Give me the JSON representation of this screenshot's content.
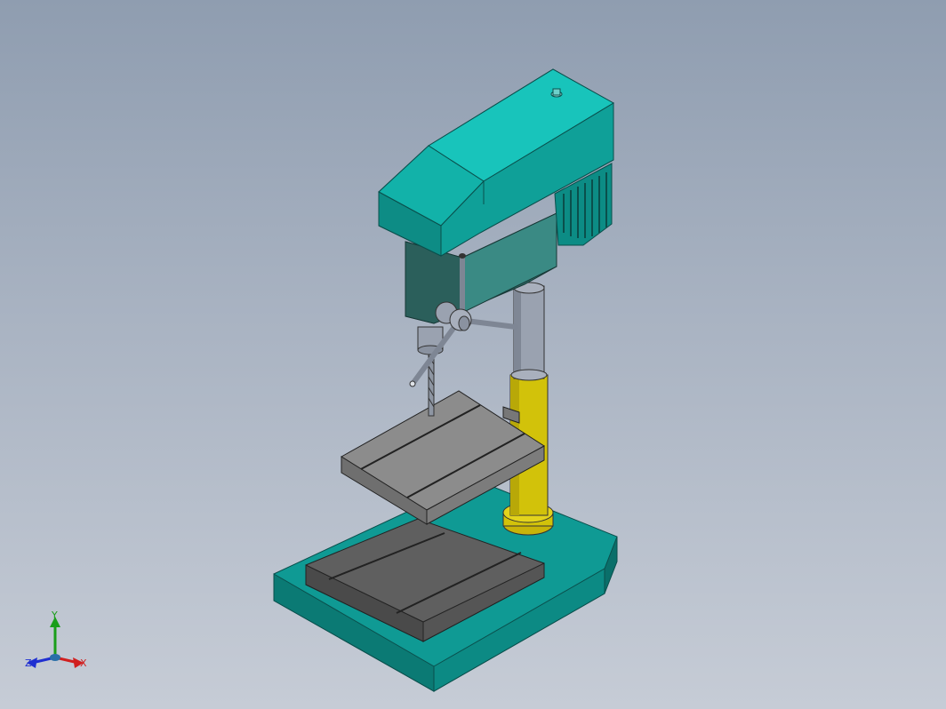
{
  "viewport": {
    "background_top": "#8f9db0",
    "background_bottom": "#c6ccd6"
  },
  "model": {
    "colors": {
      "body_teal": "#0fa8a0",
      "body_teal_light": "#18c4bb",
      "body_teal_dark": "#0b7a74",
      "column_gray": "#9aa2b0",
      "column_yellow": "#d2c20a",
      "table_gray": "#6b6b6b",
      "table_gray_light": "#8c8c8c",
      "base_teal": "#0f9a94"
    }
  },
  "triad": {
    "x_label": "X",
    "y_label": "Y",
    "z_label": "Z",
    "x_color": "#d11f1f",
    "y_color": "#1a9e1a",
    "z_color": "#1f2fd1"
  }
}
